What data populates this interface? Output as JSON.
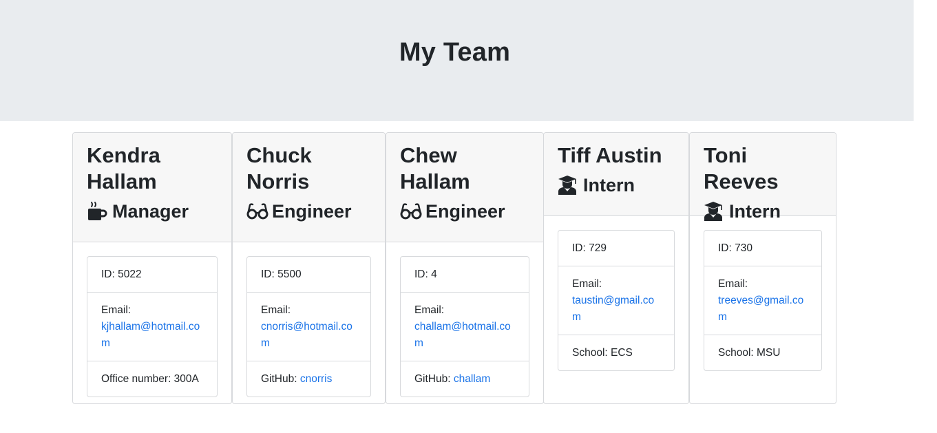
{
  "header": {
    "title": "My Team"
  },
  "employees": [
    {
      "name": "Kendra Hallam",
      "role": "Manager",
      "icon": "mug-hot-icon",
      "id_text": "ID: 5022",
      "email_label": "Email:",
      "email": "kjhallam@hotmail.com",
      "extra_label": "Office number: 300A",
      "extra_value": ""
    },
    {
      "name": "Chuck Norris",
      "role": "Engineer",
      "icon": "glasses-icon",
      "id_text": "ID: 5500",
      "email_label": "Email:",
      "email": "cnorris@hotmail.com",
      "extra_label": "GitHub: ",
      "extra_value": "cnorris"
    },
    {
      "name": "Chew Hallam",
      "role": "Engineer",
      "icon": "glasses-icon",
      "id_text": "ID: 4",
      "email_label": "Email:",
      "email": "challam@hotmail.com",
      "extra_label": "GitHub: ",
      "extra_value": "challam"
    },
    {
      "name": "Tiff Austin",
      "role": "Intern",
      "icon": "graduate-icon",
      "id_text": "ID: 729",
      "email_label": "Email:",
      "email": "taustin@gmail.com",
      "extra_label": "School: ECS",
      "extra_value": ""
    },
    {
      "name": "Toni Reeves",
      "role": "Intern",
      "icon": "graduate-icon",
      "id_text": "ID: 730",
      "email_label": "Email:",
      "email": "treeves@gmail.com",
      "extra_label": "School: MSU",
      "extra_value": ""
    }
  ],
  "colors": {
    "jumbotron": "#e9ecef",
    "link": "#1a73e8",
    "text": "#212529"
  }
}
